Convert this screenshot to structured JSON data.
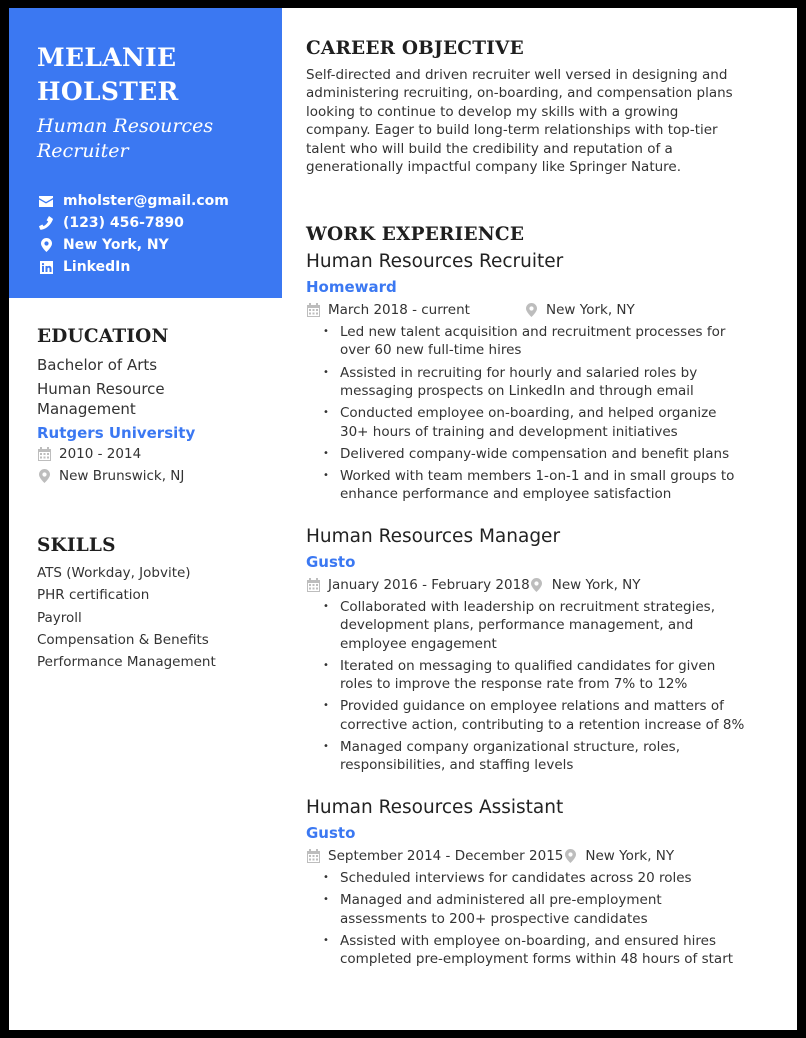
{
  "header": {
    "name_line1": "MELANIE",
    "name_line2": "HOLSTER",
    "title_line1": "Human Resources",
    "title_line2": "Recruiter",
    "accent_color": "#3b78f2",
    "contacts": [
      {
        "icon": "envelope-icon",
        "text": "mholster@gmail.com"
      },
      {
        "icon": "phone-icon",
        "text": "(123) 456-7890"
      },
      {
        "icon": "map-pin-icon",
        "text": "New York, NY"
      },
      {
        "icon": "linkedin-icon",
        "text": "LinkedIn"
      }
    ]
  },
  "education": {
    "heading": "EDUCATION",
    "degree": "Bachelor of Arts",
    "field_line1": "Human Resource",
    "field_line2": "Management",
    "school": "Rutgers University",
    "dates": "2010 - 2014",
    "location": "New Brunswick, NJ"
  },
  "skills": {
    "heading": "SKILLS",
    "items": [
      "ATS (Workday, Jobvite)",
      "PHR certification",
      "Payroll",
      "Compensation & Benefits",
      "Performance Management"
    ]
  },
  "objective": {
    "heading": "CAREER OBJECTIVE",
    "lines": [
      "Self-directed and driven recruiter well versed in designing and",
      "administering recruiting, on-boarding, and compensation plans",
      "looking to continue to develop my skills with a growing",
      "company. Eager to build long-term relationships with top-tier",
      "talent who will build the credibility and reputation of a",
      "generationally impactful company like Springer Nature."
    ]
  },
  "work": {
    "heading": "WORK EXPERIENCE",
    "jobs": [
      {
        "title": "Human Resources Recruiter",
        "company": "Homeward",
        "dates": "March 2018 - current",
        "location": "New York, NY",
        "bullets": [
          [
            "Led new talent acquisition and recruitment processes for",
            "over 60 new full-time hires"
          ],
          [
            "Assisted in recruiting for hourly and salaried roles by",
            "messaging prospects on LinkedIn and through email"
          ],
          [
            "Conducted employee on-boarding, and helped organize",
            "30+ hours of training and development initiatives"
          ],
          [
            "Delivered company-wide compensation and benefit plans"
          ],
          [
            "Worked with team members 1-on-1 and in small groups to",
            "enhance performance and employee satisfaction"
          ]
        ]
      },
      {
        "title": "Human Resources Manager",
        "company": "Gusto",
        "dates": "January 2016 - February 2018",
        "location": "New York, NY",
        "bullets": [
          [
            "Collaborated with leadership on recruitment strategies,",
            "development plans, performance management, and",
            "employee engagement"
          ],
          [
            "Iterated on messaging to qualified candidates for given",
            "roles to improve the response rate from 7% to 12%"
          ],
          [
            "Provided guidance on employee relations and matters of",
            "corrective action, contributing to a retention increase of 8%"
          ],
          [
            "Managed company organizational structure, roles,",
            "responsibilities, and staffing levels"
          ]
        ]
      },
      {
        "title": "Human Resources Assistant",
        "company": "Gusto",
        "dates": "September 2014 - December 2015",
        "location": "New York, NY",
        "bullets": [
          [
            "Scheduled interviews for candidates across 20 roles"
          ],
          [
            "Managed and administered all pre-employment",
            "assessments to 200+ prospective candidates"
          ],
          [
            "Assisted with employee on-boarding, and ensured hires",
            "completed pre-employment forms within 48 hours of start"
          ]
        ]
      }
    ]
  }
}
